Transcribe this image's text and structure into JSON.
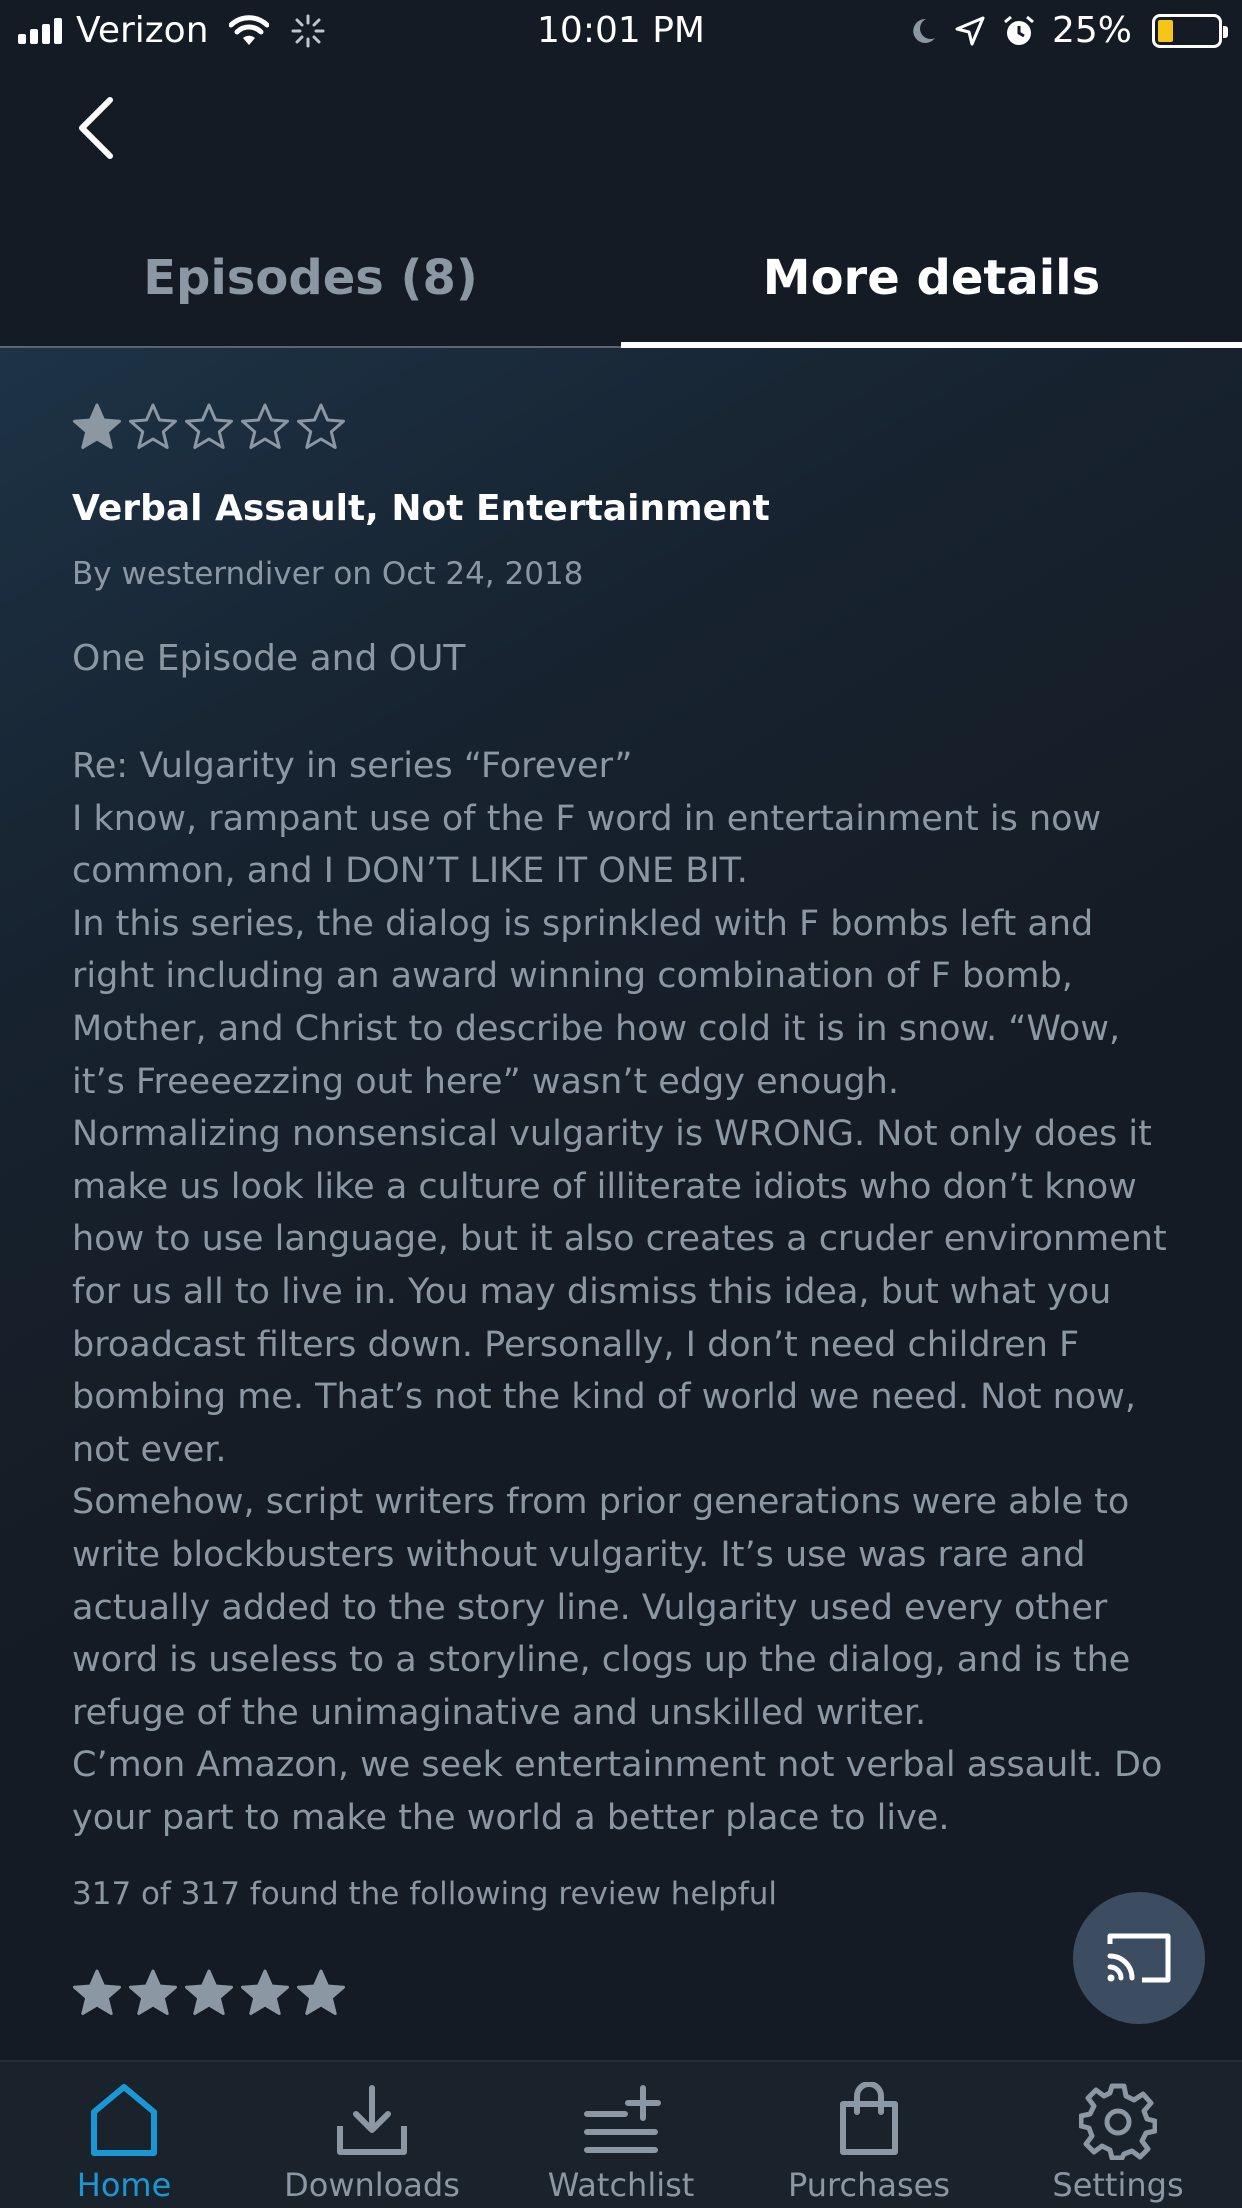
{
  "status_bar": {
    "carrier": "Verizon",
    "time": "10:01 PM",
    "battery": "25%",
    "battery_level": 0.25
  },
  "tabs": [
    {
      "label": "Episodes (8)",
      "active": false
    },
    {
      "label": "More details",
      "active": true
    }
  ],
  "review": {
    "rating": 1,
    "max_rating": 5,
    "title": "Verbal Assault, Not Entertainment",
    "meta": "By westerndiver on Oct 24, 2018",
    "summary": "One Episode and OUT",
    "body_lines": [
      "Re: Vulgarity in series “Forever”",
      "I know, rampant use of the F word in entertainment is now",
      "common, and I DON’T LIKE IT ONE BIT.",
      "In this series, the dialog is sprinkled with F bombs left and",
      "right including an award winning combination of F bomb,",
      "Mother, and Christ to describe how cold it is in snow. “Wow,",
      "it’s Freeeezzing out here” wasn’t edgy enough.",
      "Normalizing nonsensical vulgarity is WRONG. Not only does it",
      "make us look like a culture of illiterate idiots who don’t know",
      "how to use language, but it also creates a cruder environment",
      "for us all to live in. You may dismiss this idea, but what you",
      "broadcast filters down. Personally, I don’t need children F",
      "bombing me. That’s not the kind of world we need. Not now,",
      "not ever.",
      "Somehow, script writers from prior generations were able to",
      "write blockbusters without vulgarity. It’s use was rare and",
      "actually added to the story line. Vulgarity used every other",
      "word is useless to a storyline, clogs up the dialog, and is the",
      "refuge of the unimaginative and unskilled writer.",
      "C’mon Amazon, we seek entertainment not verbal assault. Do",
      "your part to make the world a better place to live."
    ],
    "helpful": "317 of 317 found the following review helpful"
  },
  "next_review": {
    "rating": 5,
    "max_rating": 5
  },
  "bottom_nav": [
    {
      "label": "Home",
      "icon": "home-icon",
      "active": true
    },
    {
      "label": "Downloads",
      "icon": "download-icon",
      "active": false
    },
    {
      "label": "Watchlist",
      "icon": "watchlist-icon",
      "active": false
    },
    {
      "label": "Purchases",
      "icon": "shopping-bag-icon",
      "active": false
    },
    {
      "label": "Settings",
      "icon": "gear-icon",
      "active": false
    }
  ],
  "colors": {
    "background": "#151b24",
    "accent": "#1a98d5",
    "star": "#8b97a3",
    "battery": "#f5c518"
  }
}
